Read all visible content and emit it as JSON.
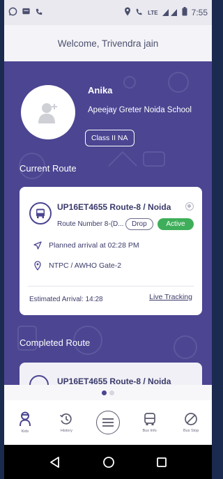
{
  "status_bar": {
    "time": "7:55",
    "network": "LTE",
    "left_icons": [
      "whatsapp-icon",
      "message-icon",
      "missed-call-icon"
    ],
    "right_icons": [
      "location-icon",
      "volte-icon",
      "signal-icon",
      "battery-icon"
    ]
  },
  "header": {
    "welcome": "Welcome, Trivendra jain"
  },
  "student": {
    "name": "Anika",
    "school": "Apeejay Greter Noida School",
    "class": "Class II NA"
  },
  "current_route": {
    "section_title": "Current Route",
    "title": "UP16ET4655 Route-8 / Noida",
    "route_number": "Route Number 8-(D...",
    "trip_type": "Drop",
    "status": "Active",
    "planned_arrival": "Planned arrival at 02:28 PM",
    "stop": "NTPC / AWHO Gate-2",
    "estimated_arrival": "Estimated Arrival: 14:28",
    "live_tracking": "Live Tracking"
  },
  "completed_route": {
    "section_title": "Completed Route",
    "title": "UP16ET4655 Route-8 / Noida"
  },
  "pager": {
    "active_index": 0,
    "count": 2
  },
  "bottom_nav": {
    "items": [
      {
        "label": "Kids",
        "icon": "kid-icon"
      },
      {
        "label": "History",
        "icon": "history-icon"
      },
      {
        "label": "",
        "icon": "menu-icon"
      },
      {
        "label": "Bus Info",
        "icon": "bus-icon"
      },
      {
        "label": "Bus Stop",
        "icon": "block-icon"
      }
    ]
  },
  "colors": {
    "primary": "#4b4592",
    "active_green": "#3fae5a",
    "text_dark": "#3a3a6a",
    "nav_active": "#4b4592"
  }
}
